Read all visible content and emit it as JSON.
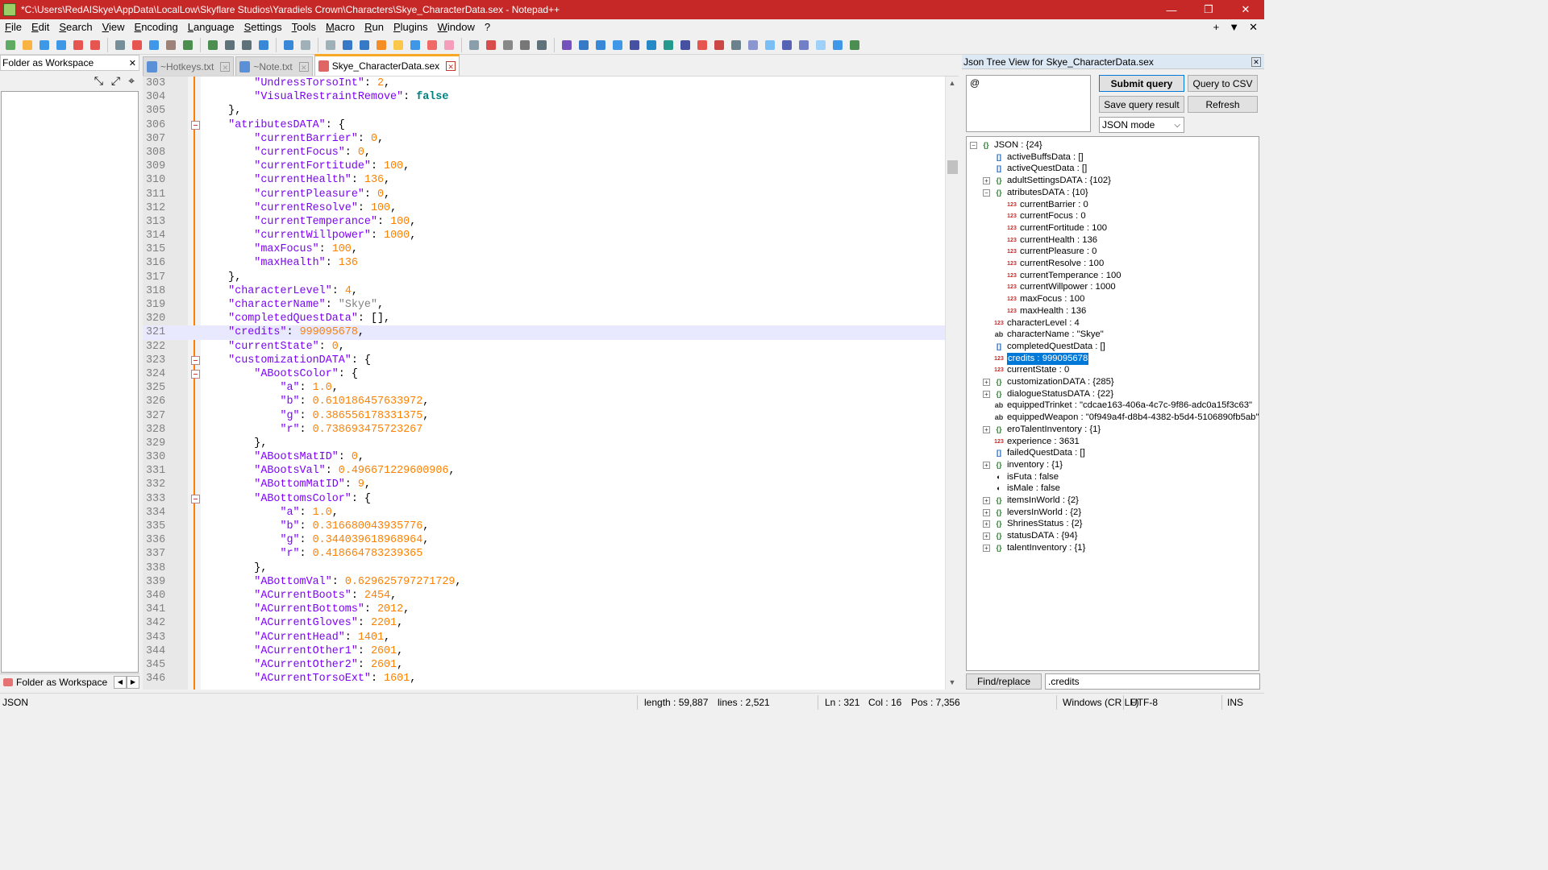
{
  "window": {
    "title": "*C:\\Users\\RedAISkye\\AppData\\LocalLow\\Skyflare Studios\\Yaradiels Crown\\Characters\\Skye_CharacterData.sex - Notepad++",
    "minimize": "—",
    "maximize": "❐",
    "close": "✕"
  },
  "menu": {
    "items": [
      "File",
      "Edit",
      "Search",
      "View",
      "Encoding",
      "Language",
      "Settings",
      "Tools",
      "Macro",
      "Run",
      "Plugins",
      "Window",
      "?"
    ],
    "right": [
      "+",
      "▼",
      "✕"
    ]
  },
  "left_panel": {
    "title": "Folder as Workspace",
    "close": "✕",
    "footer_tab": "Folder as Workspace",
    "tools": [
      "⤡",
      "⤢",
      "⌖"
    ]
  },
  "tabs": [
    {
      "label": "~Hotkeys.txt",
      "color": "#5b8fd6"
    },
    {
      "label": "~Note.txt",
      "color": "#5b8fd6"
    },
    {
      "label": "Skye_CharacterData.sex",
      "color": "#e06666"
    }
  ],
  "editor": {
    "current_line": 321,
    "lines": [
      {
        "n": 303,
        "indent": 8,
        "k": "UndressTorsoInt",
        "v": "2",
        "t": "num",
        "c": ","
      },
      {
        "n": 304,
        "indent": 8,
        "k": "VisualRestraintRemove",
        "v": "false",
        "t": "kw",
        "c": ""
      },
      {
        "n": 305,
        "indent": 4,
        "raw": "},"
      },
      {
        "n": 306,
        "indent": 4,
        "k": "atributesDATA",
        "v": "{",
        "t": "punc",
        "c": "",
        "fold": true
      },
      {
        "n": 307,
        "indent": 8,
        "k": "currentBarrier",
        "v": "0",
        "t": "num",
        "c": ","
      },
      {
        "n": 308,
        "indent": 8,
        "k": "currentFocus",
        "v": "0",
        "t": "num",
        "c": ","
      },
      {
        "n": 309,
        "indent": 8,
        "k": "currentFortitude",
        "v": "100",
        "t": "num",
        "c": ","
      },
      {
        "n": 310,
        "indent": 8,
        "k": "currentHealth",
        "v": "136",
        "t": "num",
        "c": ","
      },
      {
        "n": 311,
        "indent": 8,
        "k": "currentPleasure",
        "v": "0",
        "t": "num",
        "c": ","
      },
      {
        "n": 312,
        "indent": 8,
        "k": "currentResolve",
        "v": "100",
        "t": "num",
        "c": ","
      },
      {
        "n": 313,
        "indent": 8,
        "k": "currentTemperance",
        "v": "100",
        "t": "num",
        "c": ","
      },
      {
        "n": 314,
        "indent": 8,
        "k": "currentWillpower",
        "v": "1000",
        "t": "num",
        "c": ","
      },
      {
        "n": 315,
        "indent": 8,
        "k": "maxFocus",
        "v": "100",
        "t": "num",
        "c": ","
      },
      {
        "n": 316,
        "indent": 8,
        "k": "maxHealth",
        "v": "136",
        "t": "num",
        "c": ""
      },
      {
        "n": 317,
        "indent": 4,
        "raw": "},"
      },
      {
        "n": 318,
        "indent": 4,
        "k": "characterLevel",
        "v": "4",
        "t": "num",
        "c": ","
      },
      {
        "n": 319,
        "indent": 4,
        "k": "characterName",
        "v": "\"Skye\"",
        "t": "str",
        "c": ","
      },
      {
        "n": 320,
        "indent": 4,
        "k": "completedQuestData",
        "v": "[]",
        "t": "punc",
        "c": ","
      },
      {
        "n": 321,
        "indent": 4,
        "k": "credits",
        "v": "999095678",
        "t": "num",
        "c": ","
      },
      {
        "n": 322,
        "indent": 4,
        "k": "currentState",
        "v": "0",
        "t": "num",
        "c": ","
      },
      {
        "n": 323,
        "indent": 4,
        "k": "customizationDATA",
        "v": "{",
        "t": "punc",
        "c": "",
        "fold": true
      },
      {
        "n": 324,
        "indent": 8,
        "k": "ABootsColor",
        "v": "{",
        "t": "punc",
        "c": "",
        "fold": true
      },
      {
        "n": 325,
        "indent": 12,
        "k": "a",
        "v": "1.0",
        "t": "num",
        "c": ","
      },
      {
        "n": 326,
        "indent": 12,
        "k": "b",
        "v": "0.610186457633972",
        "t": "num",
        "c": ","
      },
      {
        "n": 327,
        "indent": 12,
        "k": "g",
        "v": "0.386556178331375",
        "t": "num",
        "c": ","
      },
      {
        "n": 328,
        "indent": 12,
        "k": "r",
        "v": "0.738693475723267",
        "t": "num",
        "c": ""
      },
      {
        "n": 329,
        "indent": 8,
        "raw": "},"
      },
      {
        "n": 330,
        "indent": 8,
        "k": "ABootsMatID",
        "v": "0",
        "t": "num",
        "c": ","
      },
      {
        "n": 331,
        "indent": 8,
        "k": "ABootsVal",
        "v": "0.496671229600906",
        "t": "num",
        "c": ","
      },
      {
        "n": 332,
        "indent": 8,
        "k": "ABottomMatID",
        "v": "9",
        "t": "num",
        "c": ","
      },
      {
        "n": 333,
        "indent": 8,
        "k": "ABottomsColor",
        "v": "{",
        "t": "punc",
        "c": "",
        "fold": true
      },
      {
        "n": 334,
        "indent": 12,
        "k": "a",
        "v": "1.0",
        "t": "num",
        "c": ","
      },
      {
        "n": 335,
        "indent": 12,
        "k": "b",
        "v": "0.316680043935776",
        "t": "num",
        "c": ","
      },
      {
        "n": 336,
        "indent": 12,
        "k": "g",
        "v": "0.344039618968964",
        "t": "num",
        "c": ","
      },
      {
        "n": 337,
        "indent": 12,
        "k": "r",
        "v": "0.418664783239365",
        "t": "num",
        "c": ""
      },
      {
        "n": 338,
        "indent": 8,
        "raw": "},"
      },
      {
        "n": 339,
        "indent": 8,
        "k": "ABottomVal",
        "v": "0.629625797271729",
        "t": "num",
        "c": ","
      },
      {
        "n": 340,
        "indent": 8,
        "k": "ACurrentBoots",
        "v": "2454",
        "t": "num",
        "c": ","
      },
      {
        "n": 341,
        "indent": 8,
        "k": "ACurrentBottoms",
        "v": "2012",
        "t": "num",
        "c": ","
      },
      {
        "n": 342,
        "indent": 8,
        "k": "ACurrentGloves",
        "v": "2201",
        "t": "num",
        "c": ","
      },
      {
        "n": 343,
        "indent": 8,
        "k": "ACurrentHead",
        "v": "1401",
        "t": "num",
        "c": ","
      },
      {
        "n": 344,
        "indent": 8,
        "k": "ACurrentOther1",
        "v": "2601",
        "t": "num",
        "c": ","
      },
      {
        "n": 345,
        "indent": 8,
        "k": "ACurrentOther2",
        "v": "2601",
        "t": "num",
        "c": ","
      },
      {
        "n": 346,
        "indent": 8,
        "k": "ACurrentTorsoExt",
        "v": "1601",
        "t": "num",
        "c": ","
      }
    ]
  },
  "json_panel": {
    "title": "Json Tree View for Skye_CharacterData.sex",
    "close": "✕",
    "query_value": "@",
    "submit_query": "Submit query",
    "query_to_csv": "Query to CSV",
    "save_query_result": "Save query result",
    "refresh": "Refresh",
    "mode": "JSON mode",
    "find_replace": "Find/replace",
    "search_value": ".credits",
    "tree": [
      {
        "level": 0,
        "expander": "−",
        "icon": "obj",
        "text": "JSON : {24}"
      },
      {
        "level": 1,
        "icon": "arr",
        "text": "activeBuffsData : []"
      },
      {
        "level": 1,
        "icon": "arr",
        "text": "activeQuestData : []"
      },
      {
        "level": 1,
        "expander": "+",
        "icon": "obj",
        "text": "adultSettingsDATA : {102}"
      },
      {
        "level": 1,
        "expander": "−",
        "icon": "obj",
        "text": "atributesDATA : {10}"
      },
      {
        "level": 2,
        "icon": "num",
        "text": "currentBarrier : 0"
      },
      {
        "level": 2,
        "icon": "num",
        "text": "currentFocus : 0"
      },
      {
        "level": 2,
        "icon": "num",
        "text": "currentFortitude : 100"
      },
      {
        "level": 2,
        "icon": "num",
        "text": "currentHealth : 136"
      },
      {
        "level": 2,
        "icon": "num",
        "text": "currentPleasure : 0"
      },
      {
        "level": 2,
        "icon": "num",
        "text": "currentResolve : 100"
      },
      {
        "level": 2,
        "icon": "num",
        "text": "currentTemperance : 100"
      },
      {
        "level": 2,
        "icon": "num",
        "text": "currentWillpower : 1000"
      },
      {
        "level": 2,
        "icon": "num",
        "text": "maxFocus : 100"
      },
      {
        "level": 2,
        "icon": "num",
        "text": "maxHealth : 136"
      },
      {
        "level": 1,
        "icon": "num",
        "text": "characterLevel : 4"
      },
      {
        "level": 1,
        "icon": "str",
        "text": "characterName : \"Skye\""
      },
      {
        "level": 1,
        "icon": "arr",
        "text": "completedQuestData : []"
      },
      {
        "level": 1,
        "icon": "num",
        "text": "credits : 999095678",
        "selected": true
      },
      {
        "level": 1,
        "icon": "num",
        "text": "currentState : 0"
      },
      {
        "level": 1,
        "expander": "+",
        "icon": "obj",
        "text": "customizationDATA : {285}"
      },
      {
        "level": 1,
        "expander": "+",
        "icon": "obj",
        "text": "dialogueStatusDATA : {22}"
      },
      {
        "level": 1,
        "icon": "str",
        "text": "equippedTrinket : \"cdcae163-406a-4c7c-9f86-adc0a15f3c63\""
      },
      {
        "level": 1,
        "icon": "str",
        "text": "equippedWeapon : \"0f949a4f-d8b4-4382-b5d4-5106890fb5ab\""
      },
      {
        "level": 1,
        "expander": "+",
        "icon": "obj",
        "text": "eroTalentInventory : {1}"
      },
      {
        "level": 1,
        "icon": "num",
        "text": "experience : 3631"
      },
      {
        "level": 1,
        "icon": "arr",
        "text": "failedQuestData : []"
      },
      {
        "level": 1,
        "expander": "+",
        "icon": "obj",
        "text": "inventory : {1}"
      },
      {
        "level": 1,
        "icon": "bool",
        "text": "isFuta : false"
      },
      {
        "level": 1,
        "icon": "bool",
        "text": "isMale : false"
      },
      {
        "level": 1,
        "expander": "+",
        "icon": "obj",
        "text": "itemsInWorld : {2}"
      },
      {
        "level": 1,
        "expander": "+",
        "icon": "obj",
        "text": "leversInWorld : {2}"
      },
      {
        "level": 1,
        "expander": "+",
        "icon": "obj",
        "text": "ShrinesStatus : {2}"
      },
      {
        "level": 1,
        "expander": "+",
        "icon": "obj",
        "text": "statusDATA : {94}"
      },
      {
        "level": 1,
        "expander": "+",
        "icon": "obj",
        "text": "talentInventory : {1}"
      }
    ]
  },
  "status": {
    "language": "JSON",
    "length": "length : 59,887",
    "lines": "lines : 2,521",
    "ln": "Ln : 321",
    "col": "Col : 16",
    "pos": "Pos : 7,356",
    "eol": "Windows (CR LF)",
    "encoding": "UTF-8",
    "mode": "INS"
  },
  "toolbar_icons": [
    "new-file",
    "open-file",
    "save",
    "save-all",
    "close",
    "close-all",
    "print",
    "cut",
    "copy",
    "paste",
    "undo",
    "redo",
    "find",
    "replace",
    "zoom-in",
    "zoom-out",
    "sync-v",
    "sync-h",
    "word-wrap",
    "show-all",
    "indent-guide",
    "udl",
    "doc-map",
    "function-list",
    "folder-workspace",
    "monitor",
    "record-macro",
    "stop-macro",
    "play-macro",
    "run-macro-multiple",
    "save-macro",
    "plugin-a",
    "plugin-b",
    "plugin-c",
    "plugin-d",
    "plugin-e",
    "plugin-f",
    "plugin-g",
    "plugin-h",
    "spell-check",
    "plugin-i",
    "plugin-j",
    "plugin-k",
    "plugin-l",
    "plugin-m",
    "plugin-n",
    "plugin-o",
    "plugin-p"
  ]
}
